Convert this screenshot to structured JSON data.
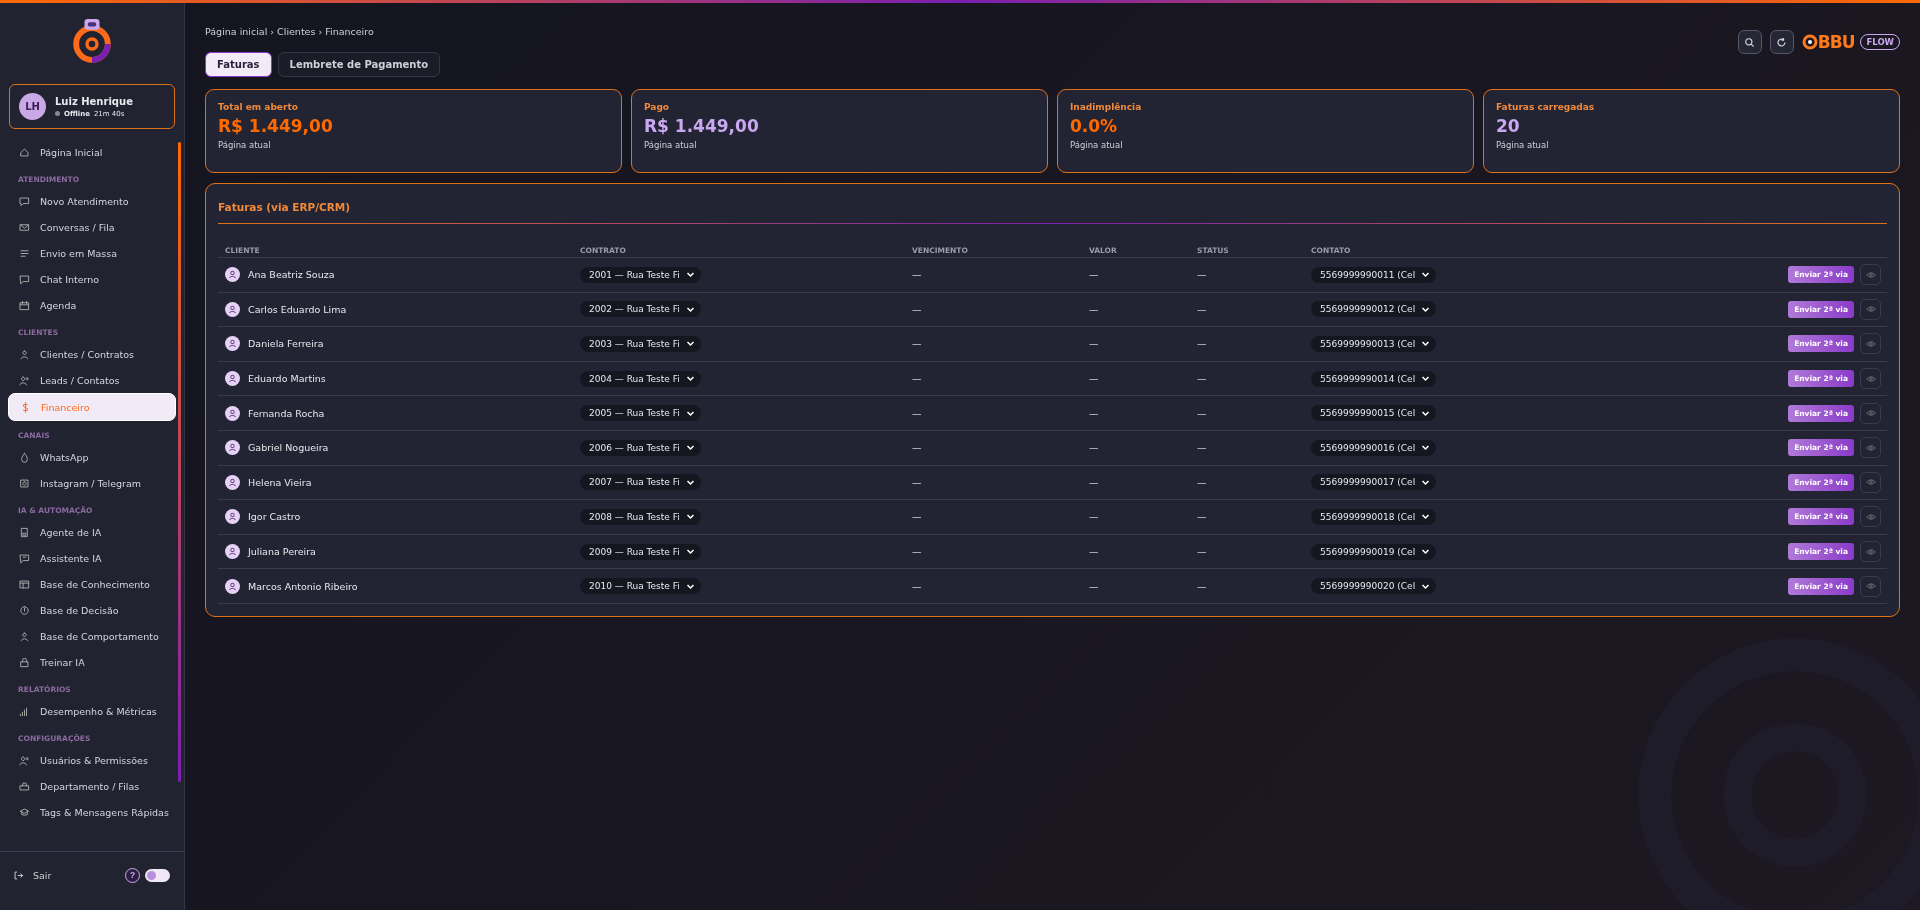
{
  "sidebar": {
    "user": {
      "initials": "LH",
      "name": "Luiz Henrique",
      "status": "Offline",
      "timer": "21m 40s"
    },
    "sections": [
      {
        "items": [
          {
            "label": "Página Inicial",
            "selected": false
          }
        ]
      },
      {
        "heading": "ATENDIMENTO",
        "items": [
          {
            "label": "Novo Atendimento",
            "selected": false
          },
          {
            "label": "Conversas / Fila",
            "selected": false
          },
          {
            "label": "Envio em Massa",
            "selected": false
          },
          {
            "label": "Chat Interno",
            "selected": false
          },
          {
            "label": "Agenda",
            "selected": false
          }
        ]
      },
      {
        "heading": "CLIENTES",
        "items": [
          {
            "label": "Clientes / Contratos",
            "selected": false
          },
          {
            "label": "Leads / Contatos",
            "selected": false
          },
          {
            "label": "Financeiro",
            "selected": true
          }
        ]
      },
      {
        "heading": "CANAIS",
        "items": [
          {
            "label": "WhatsApp",
            "selected": false
          },
          {
            "label": "Instagram / Telegram",
            "selected": false
          }
        ]
      },
      {
        "heading": "IA & AUTOMAÇÃO",
        "items": [
          {
            "label": "Agente de IA",
            "selected": false
          },
          {
            "label": "Assistente IA",
            "selected": false
          },
          {
            "label": "Base de Conhecimento",
            "selected": false
          },
          {
            "label": "Base de Decisão",
            "selected": false
          },
          {
            "label": "Base de Comportamento",
            "selected": false
          },
          {
            "label": "Treinar IA",
            "selected": false
          }
        ]
      },
      {
        "heading": "RELATÓRIOS",
        "items": [
          {
            "label": "Desempenho & Métricas",
            "selected": false
          }
        ]
      },
      {
        "heading": "CONFIGURAÇÕES",
        "items": [
          {
            "label": "Usuários & Permissões",
            "selected": false
          },
          {
            "label": "Departamento / Filas",
            "selected": false
          },
          {
            "label": "Tags & Mensagens Rápidas",
            "selected": false
          }
        ]
      }
    ],
    "footer": {
      "logout": "Sair",
      "help": "?",
      "theme_toggle": {
        "on": false
      }
    }
  },
  "breadcrumb": "Página inicial › Clientes › Financeiro",
  "brand": {
    "name": "BBU",
    "badge": "FLOW"
  },
  "tabs": [
    {
      "label": "Faturas",
      "selected": true
    },
    {
      "label": "Lembrete de Pagamento",
      "selected": false
    }
  ],
  "stats": [
    {
      "label": "Total em aberto",
      "value": "R$ 1.449,00",
      "note": "Página atual",
      "color": "#ff6a00"
    },
    {
      "label": "Pago",
      "value": "R$ 1.449,00",
      "note": "Página atual",
      "color": "#c9a8f0"
    },
    {
      "label": "Inadimplência",
      "value": "0.0%",
      "note": "Página atual",
      "color": "#ff6a00"
    },
    {
      "label": "Faturas carregadas",
      "value": "20",
      "note": "Página atual",
      "color": "#c9a8f0"
    }
  ],
  "table": {
    "title": "Faturas (via ERP/CRM)",
    "columns": [
      "CLIENTE",
      "CONTRATO",
      "VENCIMENTO",
      "VALOR",
      "STATUS",
      "CONTATO"
    ],
    "rows": [
      {
        "client": "Ana Beatriz Souza",
        "contract": "2001 — Rua Teste Fi",
        "due": "—",
        "value": "—",
        "status": "—",
        "contact": "5569999990011 (Cel",
        "action": "Enviar 2ª via"
      },
      {
        "client": "Carlos Eduardo Lima",
        "contract": "2002 — Rua Teste Fi",
        "due": "—",
        "value": "—",
        "status": "—",
        "contact": "5569999990012 (Cel",
        "action": "Enviar 2ª via"
      },
      {
        "client": "Daniela Ferreira",
        "contract": "2003 — Rua Teste Fi",
        "due": "—",
        "value": "—",
        "status": "—",
        "contact": "5569999990013 (Cel",
        "action": "Enviar 2ª via"
      },
      {
        "client": "Eduardo Martins",
        "contract": "2004 — Rua Teste Fi",
        "due": "—",
        "value": "—",
        "status": "—",
        "contact": "5569999990014 (Cel",
        "action": "Enviar 2ª via"
      },
      {
        "client": "Fernanda Rocha",
        "contract": "2005 — Rua Teste Fi",
        "due": "—",
        "value": "—",
        "status": "—",
        "contact": "5569999990015 (Cel",
        "action": "Enviar 2ª via"
      },
      {
        "client": "Gabriel Nogueira",
        "contract": "2006 — Rua Teste Fi",
        "due": "—",
        "value": "—",
        "status": "—",
        "contact": "5569999990016 (Cel",
        "action": "Enviar 2ª via"
      },
      {
        "client": "Helena Vieira",
        "contract": "2007 — Rua Teste Fi",
        "due": "—",
        "value": "—",
        "status": "—",
        "contact": "5569999990017 (Cel",
        "action": "Enviar 2ª via"
      },
      {
        "client": "Igor Castro",
        "contract": "2008 — Rua Teste Fi",
        "due": "—",
        "value": "—",
        "status": "—",
        "contact": "5569999990018 (Cel",
        "action": "Enviar 2ª via"
      },
      {
        "client": "Juliana Pereira",
        "contract": "2009 — Rua Teste Fi",
        "due": "—",
        "value": "—",
        "status": "—",
        "contact": "5569999990019 (Cel",
        "action": "Enviar 2ª via"
      },
      {
        "client": "Marcos Antonio Ribeiro",
        "contract": "2010 — Rua Teste Fi",
        "due": "—",
        "value": "—",
        "status": "—",
        "contact": "5569999990020 (Cel",
        "action": "Enviar 2ª via"
      }
    ]
  }
}
